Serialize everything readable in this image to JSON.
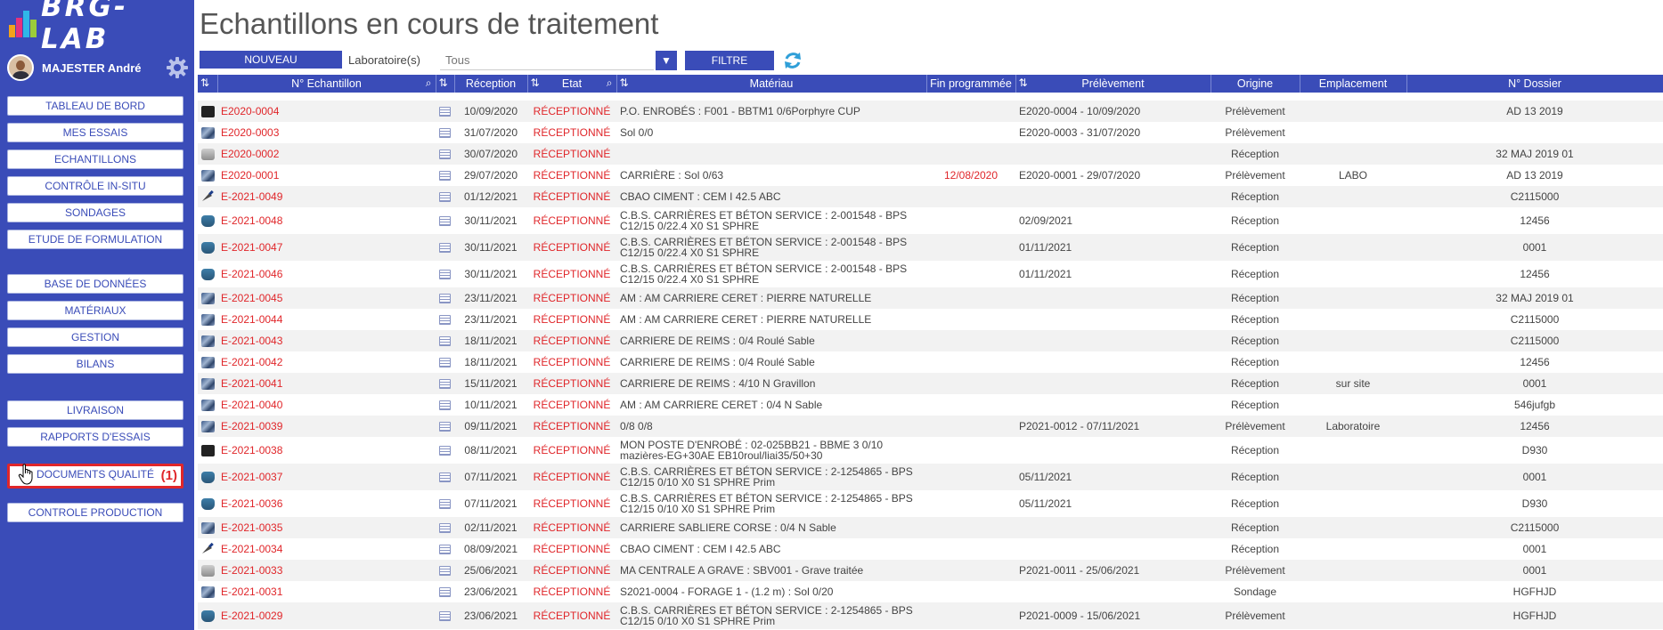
{
  "app": {
    "logo": "BRG-LAB",
    "user_name": "MAJESTER André"
  },
  "sidebar": {
    "items": [
      {
        "label": "TABLEAU DE BORD"
      },
      {
        "label": "MES ESSAIS"
      },
      {
        "label": "ECHANTILLONS"
      },
      {
        "label": "CONTRÔLE IN-SITU"
      },
      {
        "label": "SONDAGES"
      },
      {
        "label": "ETUDE DE FORMULATION"
      },
      {
        "label": "BASE DE DONNÉES"
      },
      {
        "label": "MATÉRIAUX"
      },
      {
        "label": "GESTION"
      },
      {
        "label": "BILANS"
      },
      {
        "label": "LIVRAISON"
      },
      {
        "label": "RAPPORTS D'ESSAIS"
      },
      {
        "label": "DOCUMENTS QUALITÉ",
        "badge": "(1)"
      },
      {
        "label": "CONTROLE PRODUCTION"
      }
    ]
  },
  "page": {
    "title": "Echantillons en cours de traitement"
  },
  "toolbar": {
    "new_label": "NOUVEAU",
    "lab_label": "Laboratoire(s)",
    "lab_placeholder": "Tous",
    "filter_label": "FILTRE"
  },
  "table": {
    "headers": {
      "num": "N° Echantillon",
      "reception": "Réception",
      "etat": "Etat",
      "materiau": "Matériau",
      "fin": "Fin programmée",
      "prelevement": "Prélèvement",
      "origine": "Origine",
      "emplacement": "Emplacement",
      "dossier": "N° Dossier"
    },
    "rows": [
      {
        "icon": "cube",
        "num": "E2020-0004",
        "reception": "10/09/2020",
        "etat": "RÉCEPTIONNÉ",
        "materiau": "P.O. ENROBÉS : F001 - BBTM1 0/6Porphyre CUP",
        "fin": "",
        "prelevement": "E2020-0004 - 10/09/2020",
        "origine": "Prélèvement",
        "emplacement": "",
        "dossier": "AD 13 2019"
      },
      {
        "icon": "stone",
        "num": "E2020-0003",
        "reception": "31/07/2020",
        "etat": "RÉCEPTIONNÉ",
        "materiau": "Sol 0/0",
        "fin": "",
        "prelevement": "E2020-0003 - 31/07/2020",
        "origine": "Prélèvement",
        "emplacement": "",
        "dossier": ""
      },
      {
        "icon": "drum",
        "num": "E2020-0002",
        "reception": "30/07/2020",
        "etat": "RÉCEPTIONNÉ",
        "materiau": "",
        "fin": "",
        "prelevement": "",
        "origine": "Réception",
        "emplacement": "",
        "dossier": "32 MAJ 2019 01"
      },
      {
        "icon": "stone",
        "num": "E2020-0001",
        "reception": "29/07/2020",
        "etat": "RÉCEPTIONNÉ",
        "materiau": "CARRIÈRE : Sol 0/63",
        "fin": "12/08/2020",
        "prelevement": "E2020-0001 - 29/07/2020",
        "origine": "Prélèvement",
        "emplacement": "LABO",
        "dossier": "AD 13 2019"
      },
      {
        "icon": "trowel",
        "num": "E-2021-0049",
        "reception": "01/12/2021",
        "etat": "RÉCEPTIONNÉ",
        "materiau": "CBAO CIMENT : CEM I 42.5 ABC",
        "fin": "",
        "prelevement": "",
        "origine": "Réception",
        "emplacement": "",
        "dossier": "C2115000"
      },
      {
        "icon": "truck",
        "num": "E-2021-0048",
        "reception": "30/11/2021",
        "etat": "RÉCEPTIONNÉ",
        "materiau": "C.B.S. CARRIÈRES ET BÉTON SERVICE : 2-001548 - BPS C12/15 0/22.4 X0 S1 SPHRE",
        "fin": "",
        "prelevement": "02/09/2021",
        "origine": "Réception",
        "emplacement": "",
        "dossier": "12456"
      },
      {
        "icon": "truck",
        "num": "E-2021-0047",
        "reception": "30/11/2021",
        "etat": "RÉCEPTIONNÉ",
        "materiau": "C.B.S. CARRIÈRES ET BÉTON SERVICE : 2-001548 - BPS C12/15 0/22.4 X0 S1 SPHRE",
        "fin": "",
        "prelevement": "01/11/2021",
        "origine": "Réception",
        "emplacement": "",
        "dossier": "0001"
      },
      {
        "icon": "truck",
        "num": "E-2021-0046",
        "reception": "30/11/2021",
        "etat": "RÉCEPTIONNÉ",
        "materiau": "C.B.S. CARRIÈRES ET BÉTON SERVICE : 2-001548 - BPS C12/15 0/22.4 X0 S1 SPHRE",
        "fin": "",
        "prelevement": "01/11/2021",
        "origine": "Réception",
        "emplacement": "",
        "dossier": "12456"
      },
      {
        "icon": "stone",
        "num": "E-2021-0045",
        "reception": "23/11/2021",
        "etat": "RÉCEPTIONNÉ",
        "materiau": "AM : AM CARRIERE CERET : PIERRE NATURELLE",
        "fin": "",
        "prelevement": "",
        "origine": "Réception",
        "emplacement": "",
        "dossier": "32 MAJ 2019 01"
      },
      {
        "icon": "stone",
        "num": "E-2021-0044",
        "reception": "23/11/2021",
        "etat": "RÉCEPTIONNÉ",
        "materiau": "AM : AM CARRIERE CERET : PIERRE NATURELLE",
        "fin": "",
        "prelevement": "",
        "origine": "Réception",
        "emplacement": "",
        "dossier": "C2115000"
      },
      {
        "icon": "stone",
        "num": "E-2021-0043",
        "reception": "18/11/2021",
        "etat": "RÉCEPTIONNÉ",
        "materiau": "CARRIERE DE REIMS : 0/4 Roulé Sable",
        "fin": "",
        "prelevement": "",
        "origine": "Réception",
        "emplacement": "",
        "dossier": "C2115000"
      },
      {
        "icon": "stone",
        "num": "E-2021-0042",
        "reception": "18/11/2021",
        "etat": "RÉCEPTIONNÉ",
        "materiau": "CARRIERE DE REIMS : 0/4 Roulé Sable",
        "fin": "",
        "prelevement": "",
        "origine": "Réception",
        "emplacement": "",
        "dossier": "12456"
      },
      {
        "icon": "stone",
        "num": "E-2021-0041",
        "reception": "15/11/2021",
        "etat": "RÉCEPTIONNÉ",
        "materiau": "CARRIERE DE REIMS : 4/10 N Gravillon",
        "fin": "",
        "prelevement": "",
        "origine": "Réception",
        "emplacement": "sur site",
        "dossier": "0001"
      },
      {
        "icon": "stone",
        "num": "E-2021-0040",
        "reception": "10/11/2021",
        "etat": "RÉCEPTIONNÉ",
        "materiau": "AM : AM CARRIERE CERET : 0/4 N Sable",
        "fin": "",
        "prelevement": "",
        "origine": "Réception",
        "emplacement": "",
        "dossier": "546jufgb"
      },
      {
        "icon": "stone",
        "num": "E-2021-0039",
        "reception": "09/11/2021",
        "etat": "RÉCEPTIONNÉ",
        "materiau": "0/8 0/8",
        "fin": "",
        "prelevement": "P2021-0012 - 07/11/2021",
        "origine": "Prélèvement",
        "emplacement": "Laboratoire",
        "dossier": "12456"
      },
      {
        "icon": "cube",
        "num": "E-2021-0038",
        "reception": "08/11/2021",
        "etat": "RÉCEPTIONNÉ",
        "materiau": "MON POSTE D'ENROBÉ : 02-025BB21 - BBME 3 0/10 mazières-EG+30AE EB10roul/liai35/50+30",
        "fin": "",
        "prelevement": "",
        "origine": "Réception",
        "emplacement": "",
        "dossier": "D930"
      },
      {
        "icon": "truck",
        "num": "E-2021-0037",
        "reception": "07/11/2021",
        "etat": "RÉCEPTIONNÉ",
        "materiau": "C.B.S. CARRIÈRES ET BÉTON SERVICE : 2-1254865 - BPS C12/15 0/10 X0 S1 SPHRE Prim",
        "fin": "",
        "prelevement": "05/11/2021",
        "origine": "Réception",
        "emplacement": "",
        "dossier": "0001"
      },
      {
        "icon": "truck",
        "num": "E-2021-0036",
        "reception": "07/11/2021",
        "etat": "RÉCEPTIONNÉ",
        "materiau": "C.B.S. CARRIÈRES ET BÉTON SERVICE : 2-1254865 - BPS C12/15 0/10 X0 S1 SPHRE Prim",
        "fin": "",
        "prelevement": "05/11/2021",
        "origine": "Réception",
        "emplacement": "",
        "dossier": "D930"
      },
      {
        "icon": "stone",
        "num": "E-2021-0035",
        "reception": "02/11/2021",
        "etat": "RÉCEPTIONNÉ",
        "materiau": "CARRIERE SABLIERE CORSE : 0/4 N Sable",
        "fin": "",
        "prelevement": "",
        "origine": "Réception",
        "emplacement": "",
        "dossier": "C2115000"
      },
      {
        "icon": "trowel",
        "num": "E-2021-0034",
        "reception": "08/09/2021",
        "etat": "RÉCEPTIONNÉ",
        "materiau": "CBAO CIMENT : CEM I 42.5 ABC",
        "fin": "",
        "prelevement": "",
        "origine": "Réception",
        "emplacement": "",
        "dossier": "0001"
      },
      {
        "icon": "drum",
        "num": "E-2021-0033",
        "reception": "25/06/2021",
        "etat": "RÉCEPTIONNÉ",
        "materiau": "MA CENTRALE A GRAVE : SBV001 - Grave traitée",
        "fin": "",
        "prelevement": "P2021-0011 - 25/06/2021",
        "origine": "Prélèvement",
        "emplacement": "",
        "dossier": "0001"
      },
      {
        "icon": "stone",
        "num": "E-2021-0031",
        "reception": "23/06/2021",
        "etat": "RÉCEPTIONNÉ",
        "materiau": "S2021-0004 - FORAGE 1 - (1.2 m) : Sol 0/20",
        "fin": "",
        "prelevement": "",
        "origine": "Sondage",
        "emplacement": "",
        "dossier": "HGFHJD"
      },
      {
        "icon": "truck",
        "num": "E-2021-0029",
        "reception": "23/06/2021",
        "etat": "RÉCEPTIONNÉ",
        "materiau": "C.B.S. CARRIÈRES ET BÉTON SERVICE : 2-1254865 - BPS C12/15 0/10 X0 S1 SPHRE Prim",
        "fin": "",
        "prelevement": "P2021-0009 - 15/06/2021",
        "origine": "Prélèvement",
        "emplacement": "",
        "dossier": "HGFHJD"
      }
    ]
  },
  "colors": {
    "brand": "#3a4cb8",
    "accent_red": "#e0262a",
    "row_alt": "#f2f2f2"
  }
}
